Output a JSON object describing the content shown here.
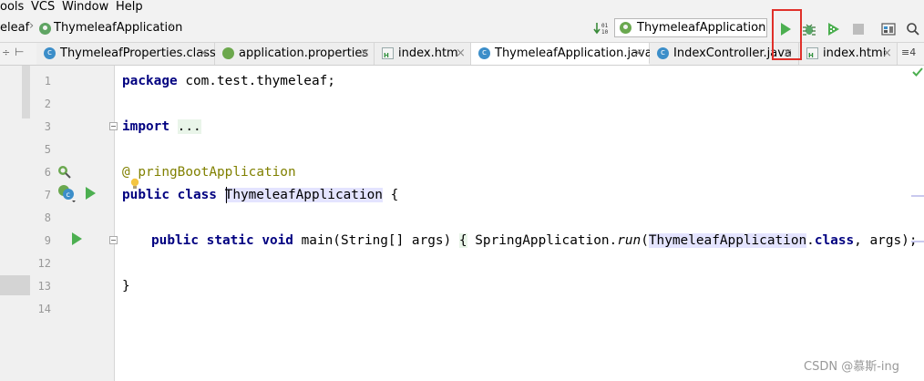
{
  "menu": {
    "items": [
      "ools",
      "VCS",
      "Window",
      "Help"
    ]
  },
  "breadcrumb": {
    "items": [
      "eleaf",
      "ThymeleafApplication"
    ]
  },
  "run_config": {
    "label": "ThymeleafApplication"
  },
  "toolbar": {
    "icons": [
      "sort-numbers-icon",
      "run-icon",
      "debug-icon",
      "coverage-icon",
      "stop-icon",
      "project-structure-icon",
      "search-icon"
    ]
  },
  "tabs": [
    {
      "label": "ThymeleafProperties.class",
      "icon": "class-icon",
      "active": false
    },
    {
      "label": "application.properties",
      "icon": "spring-icon",
      "active": false
    },
    {
      "label": "index.htm",
      "icon": "html-icon",
      "active": false
    },
    {
      "label": "ThymeleafApplication.java",
      "icon": "class-icon",
      "active": true
    },
    {
      "label": "IndexController.java",
      "icon": "class-icon",
      "active": false
    },
    {
      "label": "index.html",
      "icon": "html-icon",
      "active": false
    }
  ],
  "tabs_overflow": "≡4",
  "editor": {
    "line_numbers": [
      "1",
      "2",
      "3",
      "5",
      "6",
      "7",
      "8",
      "9",
      "12",
      "13",
      "14"
    ],
    "line1": {
      "keyword": "package",
      "text": " com.test.thymeleaf;"
    },
    "line3": {
      "keyword": "import",
      "folded": "..."
    },
    "line6": {
      "annotation_prefix": "@",
      "annotation_rest": "pringBootApplication"
    },
    "line7": {
      "kw1": "public",
      "kw2": "class",
      "class_name": "ThymeleafApplication",
      "rest": " {"
    },
    "line9": {
      "kw1": "public",
      "kw2": "static",
      "kw3": "void",
      "sig": " main(String[] args) ",
      "open_brace": "{",
      "body1": " SpringApplication.",
      "method": "run",
      "paren": "(",
      "arg_class": "ThymeleafApplication",
      "dot": ".",
      "kw_class": "class",
      "body2": ", args); ",
      "close_brace": "}"
    },
    "line13": "}"
  },
  "watermark": "CSDN @慕斯-ing",
  "colors": {
    "keyword": "#000080",
    "annotation": "#808000",
    "run_green": "#4caf50",
    "highlight_box": "#e0302a"
  }
}
